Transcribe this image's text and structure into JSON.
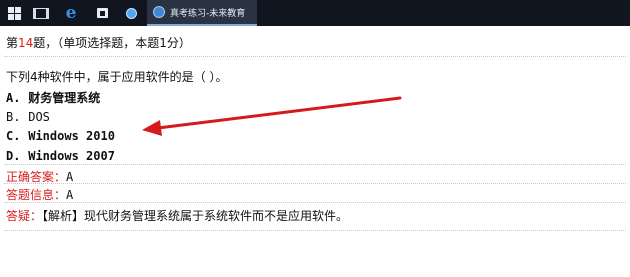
{
  "taskbar": {
    "app_title": "真考练习-未来教育"
  },
  "question": {
    "header_prefix": "第",
    "number": "14",
    "header_suffix": "题，（单项选择题，本题1分）",
    "stem": "下列4种软件中，属于应用软件的是（ ）。",
    "options": [
      {
        "letter": "A.",
        "text": "财务管理系统"
      },
      {
        "letter": "B.",
        "text": "DOS"
      },
      {
        "letter": "C.",
        "text": "Windows 2010"
      },
      {
        "letter": "D.",
        "text": "Windows 2007"
      }
    ]
  },
  "answer": {
    "correct_label": "正确答案：",
    "correct_value": "A",
    "info_label": "答题信息：",
    "info_value": "A",
    "explain_label": "答疑：",
    "explain_text": "【解析】现代财务管理系统属于系统软件而不是应用软件。"
  },
  "annotation": {
    "arrow_color": "#d41a1a"
  }
}
